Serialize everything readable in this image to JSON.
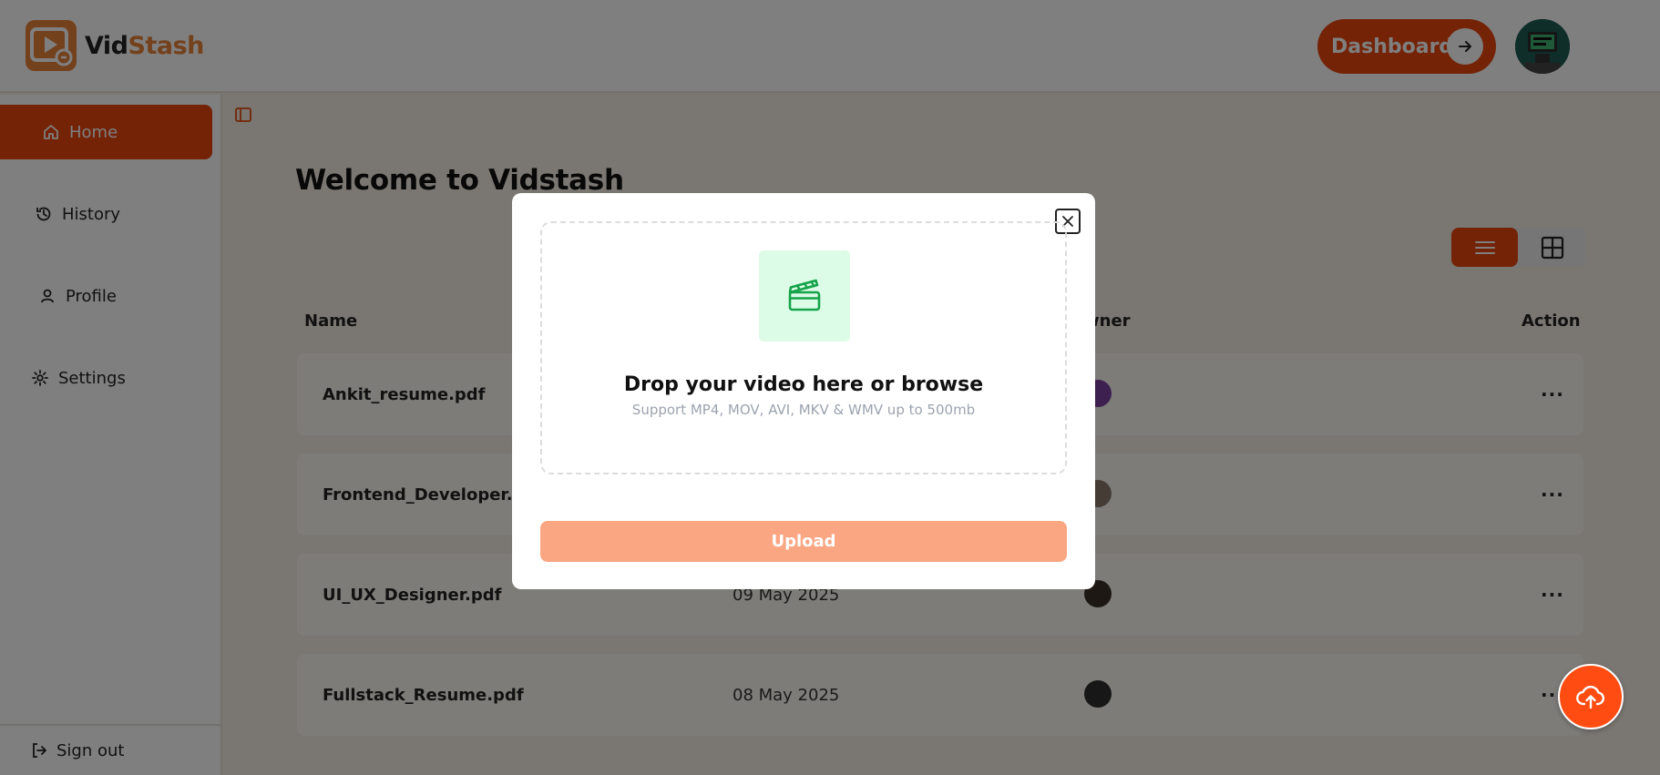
{
  "app": {
    "logo_part1": "Vid",
    "logo_part2": "Stash",
    "brand_color": "#e8470e"
  },
  "header": {
    "dashboard_label": "Dashboard"
  },
  "sidebar": {
    "items": [
      {
        "label": "Home",
        "icon": "home-icon",
        "active": true
      },
      {
        "label": "History",
        "icon": "history-icon",
        "active": false
      },
      {
        "label": "Profile",
        "icon": "user-icon",
        "active": false
      },
      {
        "label": "Settings",
        "icon": "gear-icon",
        "active": false
      }
    ],
    "signout_label": "Sign out"
  },
  "main": {
    "title": "Welcome to Vidstash",
    "columns": {
      "name": "Name",
      "owner": "wner",
      "action": "Action"
    },
    "rows": [
      {
        "name": "Ankit_resume.pdf",
        "date": ""
      },
      {
        "name": "Frontend_Developer.pdf",
        "date": ""
      },
      {
        "name": "UI_UX_Designer.pdf",
        "date": "09 May 2025"
      },
      {
        "name": "Fullstack_Resume.pdf",
        "date": "08 May 2025"
      }
    ],
    "action_glyph": "···"
  },
  "modal": {
    "drop_title": "Drop your video here or browse",
    "drop_subtitle": "Support MP4, MOV, AVI, MKV & WMV up to 500mb",
    "upload_label": "Upload"
  }
}
